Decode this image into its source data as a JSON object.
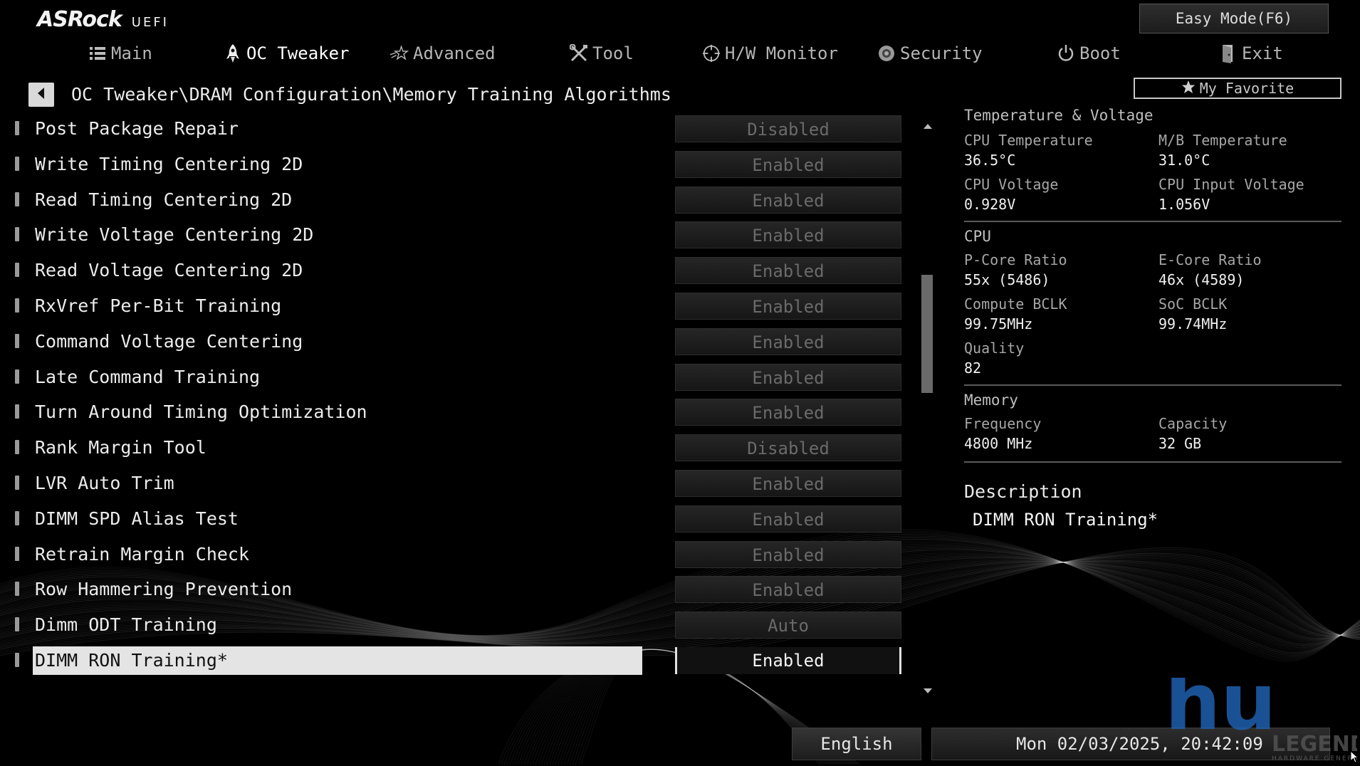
{
  "header": {
    "brand": "ASRock",
    "brand_sub": "UEFI",
    "easy_mode_label": "Easy Mode(F6)",
    "tabs": [
      {
        "label": "Main",
        "icon": "list-icon",
        "active": false
      },
      {
        "label": "OC Tweaker",
        "icon": "rocket-icon",
        "active": true
      },
      {
        "label": "Advanced",
        "icon": "star-icon",
        "active": false
      },
      {
        "label": "Tool",
        "icon": "tools-icon",
        "active": false
      },
      {
        "label": "H/W Monitor",
        "icon": "crosshair-icon",
        "active": false
      },
      {
        "label": "Security",
        "icon": "shield-icon",
        "active": false
      },
      {
        "label": "Boot",
        "icon": "power-icon",
        "active": false
      },
      {
        "label": "Exit",
        "icon": "exit-door-icon",
        "active": false
      }
    ]
  },
  "breadcrumb": "OC Tweaker\\DRAM Configuration\\Memory Training Algorithms",
  "favorite_label": "My Favorite",
  "settings": [
    {
      "label": "Post Package Repair",
      "value": "Disabled"
    },
    {
      "label": "Write Timing Centering 2D",
      "value": "Enabled"
    },
    {
      "label": "Read Timing Centering 2D",
      "value": "Enabled"
    },
    {
      "label": "Write Voltage Centering 2D",
      "value": "Enabled"
    },
    {
      "label": "Read Voltage Centering 2D",
      "value": "Enabled"
    },
    {
      "label": "RxVref Per-Bit Training",
      "value": "Enabled"
    },
    {
      "label": "Command Voltage Centering",
      "value": "Enabled"
    },
    {
      "label": "Late Command Training",
      "value": "Enabled"
    },
    {
      "label": "Turn Around Timing Optimization",
      "value": "Enabled"
    },
    {
      "label": "Rank Margin Tool",
      "value": "Disabled"
    },
    {
      "label": "LVR Auto Trim",
      "value": "Enabled"
    },
    {
      "label": "DIMM SPD Alias Test",
      "value": "Enabled"
    },
    {
      "label": "Retrain Margin Check",
      "value": "Enabled"
    },
    {
      "label": "Row Hammering Prevention",
      "value": "Enabled"
    },
    {
      "label": "Dimm ODT Training",
      "value": "Auto"
    },
    {
      "label": "DIMM RON Training*",
      "value": "Enabled",
      "selected": true
    }
  ],
  "panel": {
    "temp_voltage": {
      "title": "Temperature & Voltage",
      "cpu_temp_label": "CPU Temperature",
      "cpu_temp": "36.5°C",
      "mb_temp_label": "M/B Temperature",
      "mb_temp": "31.0°C",
      "cpu_voltage_label": "CPU Voltage",
      "cpu_voltage": "0.928V",
      "cpu_input_voltage_label": "CPU Input Voltage",
      "cpu_input_voltage": "1.056V"
    },
    "cpu": {
      "title": "CPU",
      "pcore_label": "P-Core Ratio",
      "pcore": "55x (5486)",
      "ecore_label": "E-Core Ratio",
      "ecore": "46x (4589)",
      "compute_bclk_label": "Compute BCLK",
      "compute_bclk": "99.75MHz",
      "soc_bclk_label": "SoC BCLK",
      "soc_bclk": "99.74MHz",
      "quality_label": "Quality",
      "quality": "82"
    },
    "memory": {
      "title": "Memory",
      "frequency_label": "Frequency",
      "frequency": "4800 MHz",
      "capacity_label": "Capacity",
      "capacity": "32 GB"
    },
    "description_title": "Description",
    "description_text": "DIMM RON Training*"
  },
  "footer": {
    "language": "English",
    "datetime": "Mon 02/03/2025, 20:42:09"
  },
  "watermark": {
    "letters": "hu",
    "word": "LEGEND",
    "tagline": "HARDWARE GENERATION"
  },
  "colors": {
    "background": "#000000",
    "text": "#ececec",
    "value_inactive": "#6a6a6a",
    "selected_row": "#e4e4e4",
    "watermark_blue": "#1e5fae"
  }
}
